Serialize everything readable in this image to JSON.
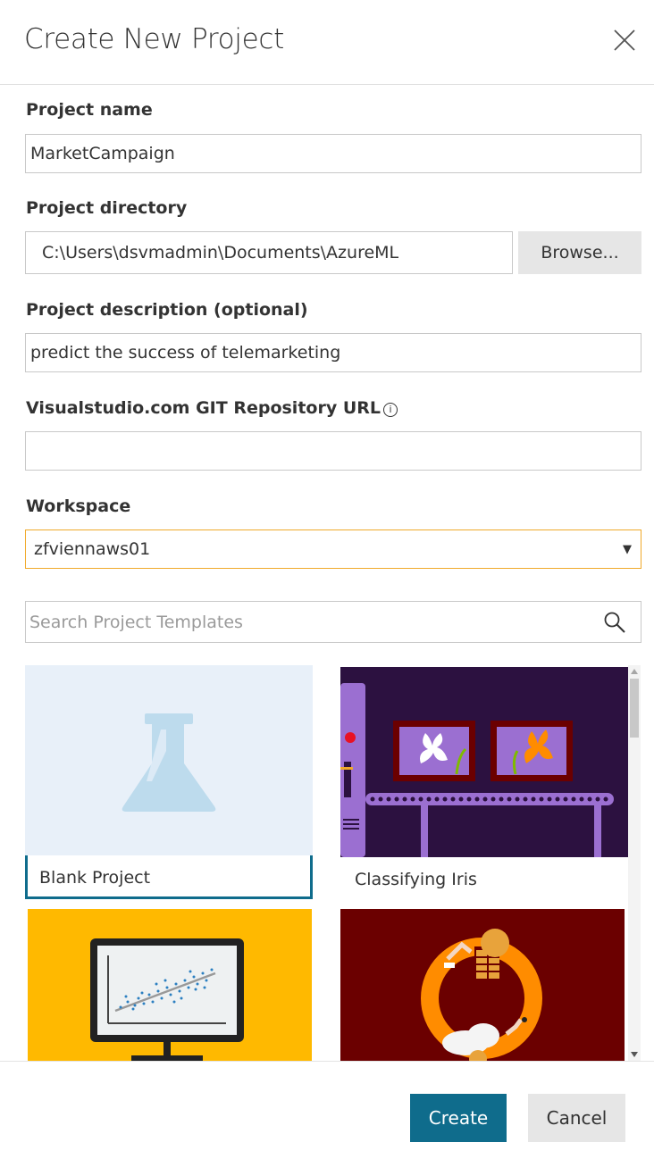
{
  "dialog": {
    "title": "Create New Project"
  },
  "project_name": {
    "label": "Project name",
    "value": "MarketCampaign"
  },
  "project_directory": {
    "label": "Project directory",
    "value": "C:\\Users\\dsvmadmin\\Documents\\AzureML",
    "browse_label": "Browse..."
  },
  "project_description": {
    "label": "Project description (optional)",
    "value": "predict the success of telemarketing"
  },
  "git_repo": {
    "label": "Visualstudio.com GIT Repository URL",
    "info_glyph": "i",
    "value": ""
  },
  "workspace": {
    "label": "Workspace",
    "value": "zfviennaws01",
    "arrow": "▼"
  },
  "template_search": {
    "placeholder": "Search Project Templates"
  },
  "templates": [
    {
      "name": "Blank Project",
      "selected": true,
      "icon": "flask-icon"
    },
    {
      "name": "Classifying Iris",
      "selected": false,
      "icon": "iris-conveyor-illustration"
    },
    {
      "name": "",
      "selected": false,
      "icon": "scatter-plot-monitor-illustration"
    },
    {
      "name": "",
      "selected": false,
      "icon": "data-cycle-illustration"
    }
  ],
  "footer": {
    "create_label": "Create",
    "cancel_label": "Cancel"
  },
  "colors": {
    "accent": "#0f6c8c",
    "focus_border": "#f0a92a",
    "tile_blank_bg": "#e8f0f9",
    "tile_iris_bg": "#2c1140",
    "tile_plot_bg": "#ffb900",
    "tile_cycle_bg": "#6b0000"
  }
}
